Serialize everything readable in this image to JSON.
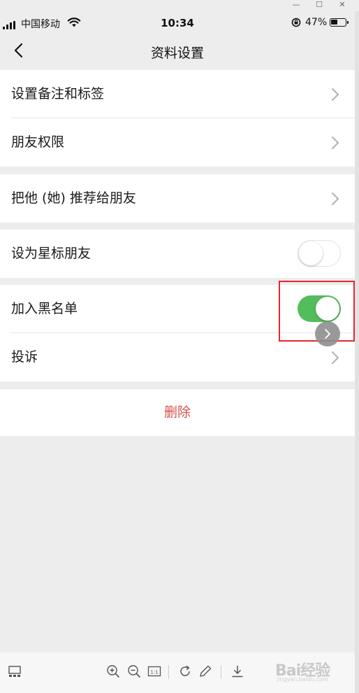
{
  "status_bar": {
    "carrier": "中国移动",
    "time": "10:34",
    "battery_percent": "47%",
    "battery_level": 0.47
  },
  "nav": {
    "title": "资料设置",
    "back_icon": "chevron-left-icon"
  },
  "settings": {
    "remark_tags": "设置备注和标签",
    "friend_permissions": "朋友权限",
    "recommend": "把他 (她) 推荐给朋友",
    "star_friend": "设为星标朋友",
    "star_friend_on": false,
    "blacklist": "加入黑名单",
    "blacklist_on": true,
    "complain": "投诉",
    "delete": "删除"
  },
  "colors": {
    "toggle_on": "#54bd5b",
    "delete_text": "#d6504d",
    "highlight_border": "#e8262d",
    "background": "#ededed"
  },
  "toolbar": {
    "icons": [
      "thumbnail-icon",
      "zoom-in-icon",
      "zoom-out-icon",
      "actual-size-icon",
      "rotate-icon",
      "edit-icon",
      "download-icon"
    ],
    "actual_size_label": "1:1"
  },
  "watermark": {
    "text": "Bai经验",
    "sub": "jingyan.baidu.com"
  }
}
